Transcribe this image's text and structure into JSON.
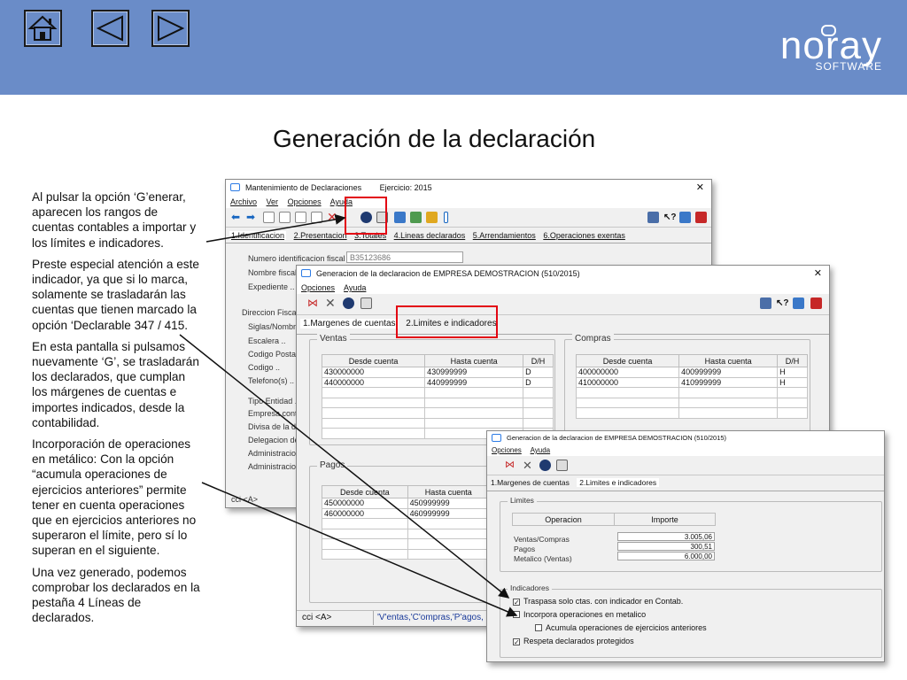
{
  "header": {
    "logo_text": "noray",
    "logo_sub": "SOFTWARE",
    "nav": [
      "home-icon",
      "back-triangle-icon",
      "forward-triangle-icon"
    ]
  },
  "slide": {
    "title": "Generación de la declaración",
    "paragraphs": [
      "Al pulsar la opción ‘G’enerar, aparecen los rangos de cuentas contables a importar y los límites e indicadores.",
      "Preste especial atención a este indicador, ya que si lo marca, solamente se trasladarán las cuentas que tienen marcado la opción ‘Declarable 347 / 415.",
      "En esta pantalla si pulsamos nuevamente ‘G’, se trasladarán los declarados, que cumplan los márgenes de cuentas e importes indicados, desde la contabilidad.",
      "Incorporación de operaciones en metálico: Con la opción “acumula operaciones de ejercicios anteriores” permite tener en cuenta operaciones que en ejercicios anteriores no superaron el límite, pero sí lo superan en el siguiente.",
      "Una vez generado, podemos comprobar los declarados en la pestaña 4 Líneas de declarados."
    ]
  },
  "win1": {
    "title": "Mantenimiento de Declaraciones",
    "ejercicio": "Ejercicio: 2015",
    "close": "✕",
    "menu": [
      "Archivo",
      "Ver",
      "Opciones",
      "Ayuda"
    ],
    "tabs": [
      "1.Identificacion",
      "2.Presentacion",
      "3.Totales",
      "4.Lineas declarados",
      "5.Arrendamientos",
      "6.Operaciones exentas"
    ],
    "fields": {
      "nif_label": "Numero identificacion fiscal ..",
      "nif_value": "B35123686",
      "nombre_label": "Nombre fiscal",
      "expediente_label": "Expediente .."
    },
    "direccion": {
      "group": "Direccion Fiscal",
      "labels": [
        "Siglas/Nombre",
        "Escalera ..",
        "Codigo Postal",
        "Codigo ..",
        "Telefono(s) .."
      ]
    },
    "other_labels": [
      "Tipo Entidad ..",
      "Empresa cont",
      "Divisa de la de",
      "Delegacion de",
      "Administracion",
      "Administracion"
    ],
    "status": "cci <A>"
  },
  "win2": {
    "title": "Generacion de la declaracion de EMPRESA DEMOSTRACION (510/2015)",
    "close": "✕",
    "menu": [
      "Opciones",
      "Ayuda"
    ],
    "tabs": [
      "1.Margenes de cuentas",
      "2.Limites e indicadores"
    ],
    "ventas": {
      "label": "Ventas",
      "cols": [
        "Desde cuenta",
        "Hasta cuenta",
        "D/H"
      ],
      "rows": [
        [
          "430000000",
          "430999999",
          "D"
        ],
        [
          "440000000",
          "440999999",
          "D"
        ]
      ]
    },
    "compras": {
      "label": "Compras",
      "cols": [
        "Desde cuenta",
        "Hasta cuenta",
        "D/H"
      ],
      "rows": [
        [
          "400000000",
          "400999999",
          "H"
        ],
        [
          "410000000",
          "410999999",
          "H"
        ]
      ]
    },
    "pagos": {
      "label": "Pagos",
      "cols": [
        "Desde cuenta",
        "Hasta cuenta"
      ],
      "rows": [
        [
          "450000000",
          "450999999"
        ],
        [
          "460000000",
          "460999999"
        ]
      ]
    },
    "status_left": "cci <A>",
    "status_right": "'V'entas,'C'ompras,'P'agos, s"
  },
  "win3": {
    "title": "Generacion de la declaracion de EMPRESA DEMOSTRACION (510/2015)",
    "menu": [
      "Opciones",
      "Ayuda"
    ],
    "tabs": [
      "1.Margenes de cuentas",
      "2.Limites e indicadores"
    ],
    "limites": {
      "label": "Limites",
      "cols": [
        "Operacion",
        "Importe"
      ],
      "rows": [
        {
          "label": "Ventas/Compras",
          "value": "3.005,06"
        },
        {
          "label": "Pagos",
          "value": "300,51"
        },
        {
          "label": "Metalico (Ventas)",
          "value": "6.000,00"
        }
      ]
    },
    "indicadores": {
      "label": "Indicadores",
      "items": [
        {
          "label": "Traspasa solo ctas. con indicador en Contab.",
          "checked": true
        },
        {
          "label": "Incorpora operaciones en metalico",
          "checked": false
        },
        {
          "label": "Acumula operaciones de ejercicios anteriores",
          "checked": false
        },
        {
          "label": "Respeta declarados protegidos",
          "checked": true
        }
      ]
    }
  },
  "colors": {
    "header": "#6a8cc8",
    "highlight": "#e30613"
  }
}
